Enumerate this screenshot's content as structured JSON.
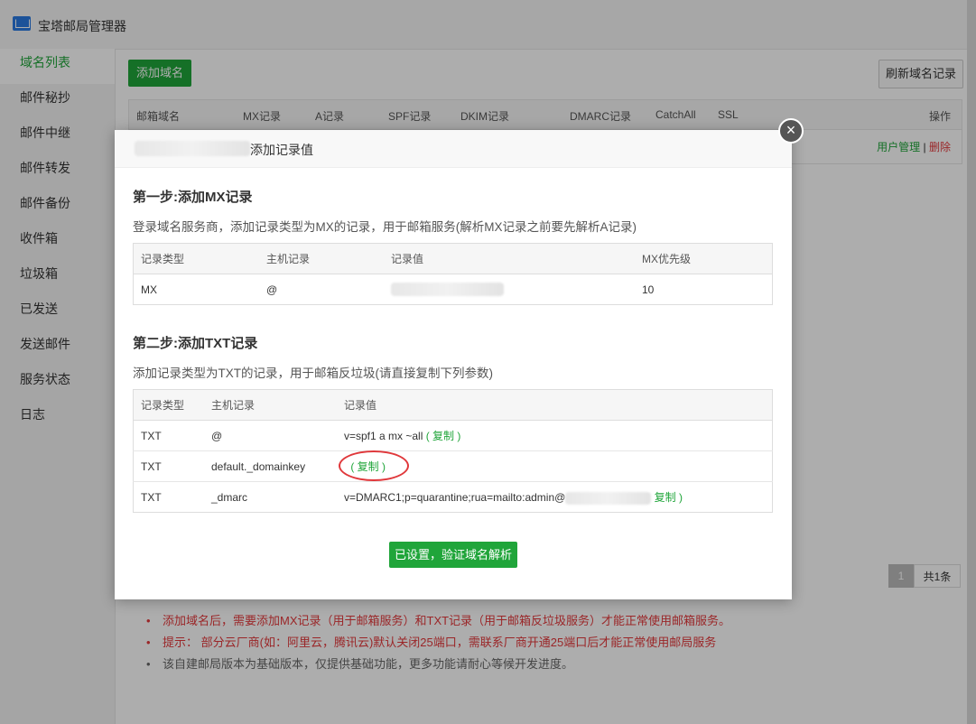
{
  "app": {
    "title": "宝塔邮局管理器"
  },
  "sidebar": {
    "items": [
      {
        "label": "域名列表"
      },
      {
        "label": "邮件秘抄"
      },
      {
        "label": "邮件中继"
      },
      {
        "label": "邮件转发"
      },
      {
        "label": "邮件备份"
      },
      {
        "label": "收件箱"
      },
      {
        "label": "垃圾箱"
      },
      {
        "label": "已发送"
      },
      {
        "label": "发送邮件"
      },
      {
        "label": "服务状态"
      },
      {
        "label": "日志"
      }
    ]
  },
  "toolbar": {
    "add_label": "添加域名",
    "refresh_label": "刷新域名记录"
  },
  "domain_table": {
    "headers": [
      "邮箱域名",
      "MX记录",
      "A记录",
      "SPF记录",
      "DKIM记录",
      "DMARC记录",
      "CatchAll",
      "SSL",
      "操作"
    ],
    "row_ops": {
      "manage": "用户管理",
      "sep": "|",
      "delete": "删除"
    }
  },
  "pager": {
    "current": "1",
    "total": "共1条"
  },
  "notes": [
    "添加域名后，需要添加MX记录（用于邮箱服务）和TXT记录（用于邮箱反垃圾服务）才能正常使用邮箱服务。",
    "提示： 部分云厂商(如：阿里云，腾讯云)默认关闭25端口，需联系厂商开通25端口后才能正常使用邮局服务",
    "该自建邮局版本为基础版本，仅提供基础功能，更多功能请耐心等候开发进度。"
  ],
  "modal": {
    "title": "添加记录值",
    "close": "×",
    "step1": {
      "title": "第一步:添加MX记录",
      "desc": "登录域名服务商，添加记录类型为MX的记录，用于邮箱服务(解析MX记录之前要先解析A记录)",
      "headers": [
        "记录类型",
        "主机记录",
        "记录值",
        "MX优先级"
      ],
      "row": {
        "type": "MX",
        "host": "@",
        "priority": "10"
      }
    },
    "step2": {
      "title": "第二步:添加TXT记录",
      "desc": "添加记录类型为TXT的记录，用于邮箱反垃圾(请直接复制下列参数)",
      "headers": [
        "记录类型",
        "主机记录",
        "记录值"
      ],
      "rows": [
        {
          "type": "TXT",
          "host": "@",
          "value": "v=spf1 a mx ~all",
          "copy": "( 复制 )"
        },
        {
          "type": "TXT",
          "host": "default._domainkey",
          "value": "",
          "copy": "( 复制 )"
        },
        {
          "type": "TXT",
          "host": "_dmarc",
          "value": "v=DMARC1;p=quarantine;rua=mailto:admin@",
          "copy": "复制 )"
        }
      ]
    },
    "verify_label": "已设置，验证域名解析"
  }
}
